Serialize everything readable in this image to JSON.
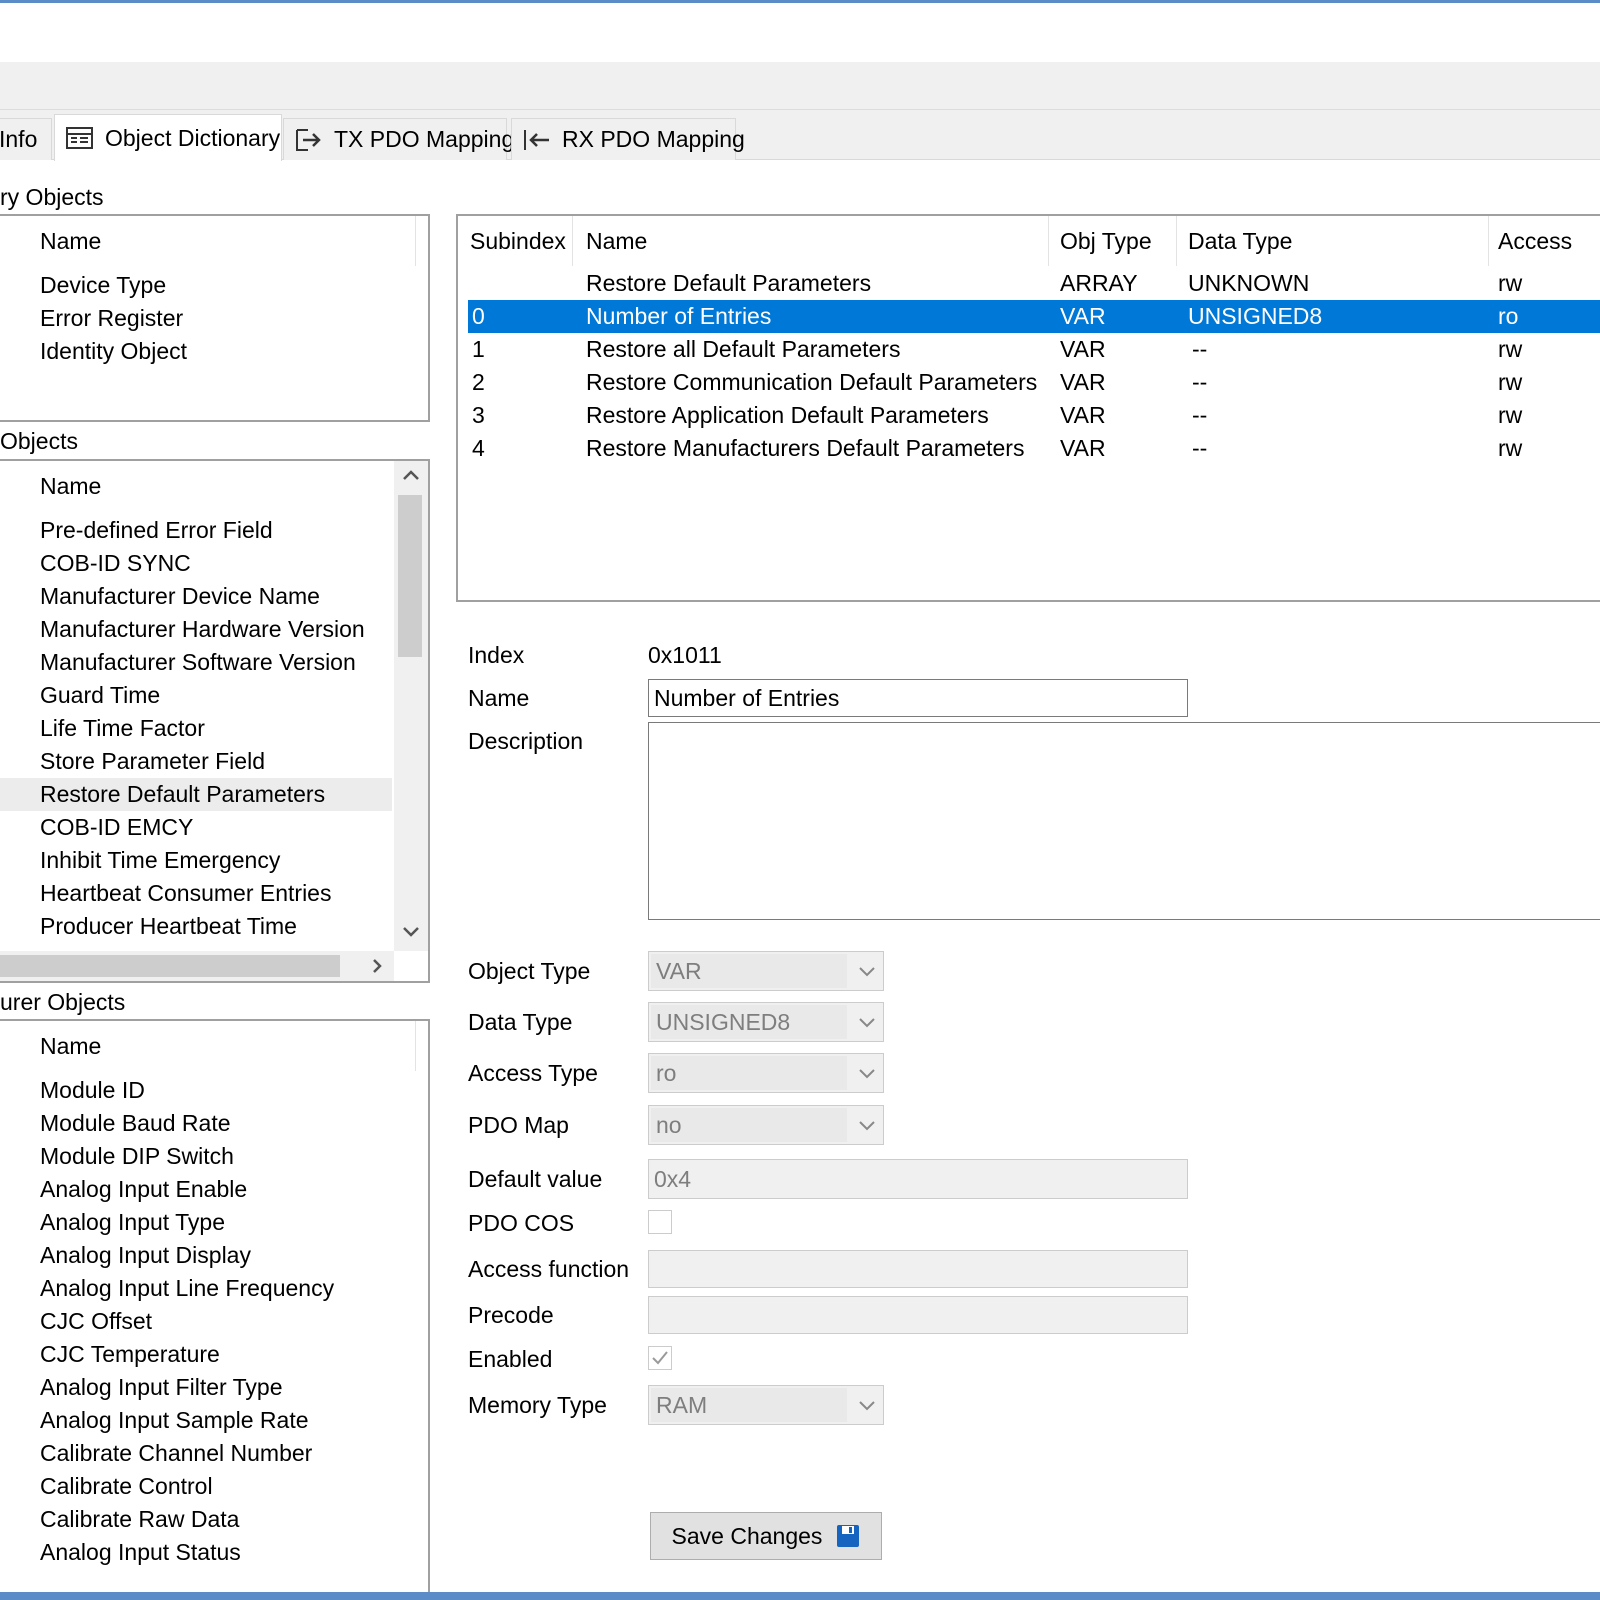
{
  "tabs": [
    {
      "label": "Info"
    },
    {
      "label": "Object Dictionary"
    },
    {
      "label": "TX PDO Mapping"
    },
    {
      "label": "RX PDO Mapping"
    }
  ],
  "mandatory": {
    "label": "ry Objects",
    "header": "Name",
    "items": [
      "Device Type",
      "Error Register",
      "Identity Object"
    ]
  },
  "optional": {
    "label": "Objects",
    "header": "Name",
    "items": [
      "Pre-defined Error Field",
      "COB-ID SYNC",
      "Manufacturer Device Name",
      "Manufacturer Hardware Version",
      "Manufacturer Software Version",
      "Guard Time",
      "Life Time Factor",
      "Store Parameter Field",
      "Restore Default Parameters",
      "COB-ID EMCY",
      "Inhibit Time Emergency",
      "Heartbeat Consumer Entries",
      "Producer Heartbeat Time"
    ],
    "highlighted_index": 8
  },
  "manufacturer": {
    "label": "urer Objects",
    "header": "Name",
    "items": [
      "Module ID",
      "Module Baud Rate",
      "Module DIP Switch",
      "Analog Input Enable",
      "Analog Input Type",
      "Analog Input Display",
      "Analog Input Line Frequency",
      "CJC Offset",
      "CJC Temperature",
      "Analog Input Filter Type",
      "Analog Input Sample Rate",
      "Calibrate Channel Number",
      "Calibrate Control",
      "Calibrate Raw Data",
      "Analog Input Status"
    ]
  },
  "subindex_grid": {
    "columns": [
      "Subindex",
      "Name",
      "Obj Type",
      "Data Type",
      "Access"
    ],
    "rows": [
      {
        "sub": "",
        "name": "Restore Default Parameters",
        "obj": "ARRAY",
        "dtype": "UNKNOWN",
        "access": "rw"
      },
      {
        "sub": "0",
        "name": "Number of Entries",
        "obj": "VAR",
        "dtype": "UNSIGNED8",
        "access": "ro"
      },
      {
        "sub": "1",
        "name": "Restore all Default Parameters",
        "obj": "VAR",
        "dtype": "--",
        "access": "rw"
      },
      {
        "sub": "2",
        "name": "Restore Communication Default Parameters",
        "obj": "VAR",
        "dtype": "--",
        "access": "rw"
      },
      {
        "sub": "3",
        "name": "Restore Application Default Parameters",
        "obj": "VAR",
        "dtype": "--",
        "access": "rw"
      },
      {
        "sub": "4",
        "name": "Restore Manufacturers Default Parameters",
        "obj": "VAR",
        "dtype": "--",
        "access": "rw"
      }
    ],
    "selected_index": 1
  },
  "details": {
    "index_label": "Index",
    "index_value": "0x1011",
    "name_label": "Name",
    "name_value": "Number of Entries",
    "description_label": "Description",
    "description_value": "",
    "object_type_label": "Object Type",
    "object_type_value": "VAR",
    "data_type_label": "Data Type",
    "data_type_value": "UNSIGNED8",
    "access_type_label": "Access Type",
    "access_type_value": "ro",
    "pdo_map_label": "PDO Map",
    "pdo_map_value": "no",
    "default_value_label": "Default value",
    "default_value_value": "0x4",
    "pdo_cos_label": "PDO COS",
    "pdo_cos_checked": false,
    "access_function_label": "Access function",
    "access_function_value": "",
    "precode_label": "Precode",
    "precode_value": "",
    "enabled_label": "Enabled",
    "enabled_checked": true,
    "memory_type_label": "Memory Type",
    "memory_type_value": "RAM"
  },
  "save_button_label": "Save Changes",
  "colors": {
    "selection": "#0078d7",
    "hover_row": "#ececec",
    "window_border": "#5b8cc8",
    "save_icon": "#1565c0"
  }
}
